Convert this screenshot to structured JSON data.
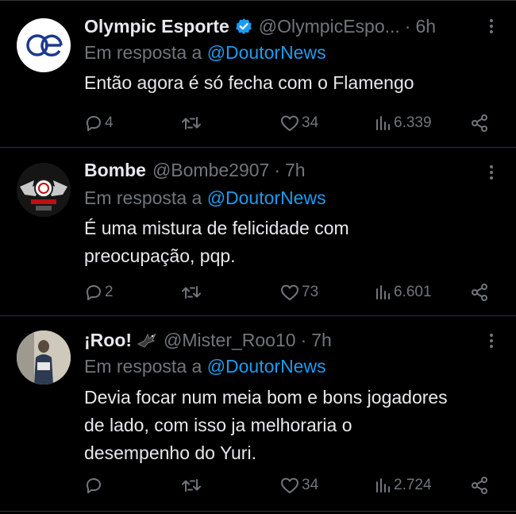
{
  "tweets": [
    {
      "name": "Olympic Esporte",
      "verified": true,
      "handle": "@OlympicEspo...",
      "dot": "·",
      "time": "6h",
      "reply_prefix": "Em resposta a",
      "reply_to": "@DoutorNews",
      "text_lines": [
        "Então agora é só fecha com o Flamengo"
      ],
      "replies": "4",
      "retweets": "",
      "likes": "34",
      "views": "6.339",
      "avatar_letters": "oe"
    },
    {
      "name": "Bombe",
      "verified": false,
      "handle": "@Bombe2907",
      "dot": "·",
      "time": "7h",
      "reply_prefix": "Em resposta a",
      "reply_to": "@DoutorNews",
      "text_lines": [
        "É uma mistura de felicidade com",
        "preocupação, pqp."
      ],
      "replies": "2",
      "retweets": "",
      "likes": "73",
      "views": "6.601"
    },
    {
      "name": "¡Roo!",
      "verified": false,
      "handle": "@Mister_Roo10",
      "dot": "·",
      "time": "7h",
      "reply_prefix": "Em resposta a",
      "reply_to": "@DoutorNews",
      "text_lines": [
        "Devia focar num meia bom e bons jogadores",
        "de lado, com isso ja melhoraria o",
        "desempenho do Yuri."
      ],
      "replies": "",
      "retweets": "",
      "likes": "34",
      "views": "2.724"
    }
  ],
  "colors": {
    "background": "#000000",
    "text": "#e7e9ea",
    "muted": "#71767b",
    "accent": "#1d9bf0",
    "divider": "#2f3336"
  }
}
